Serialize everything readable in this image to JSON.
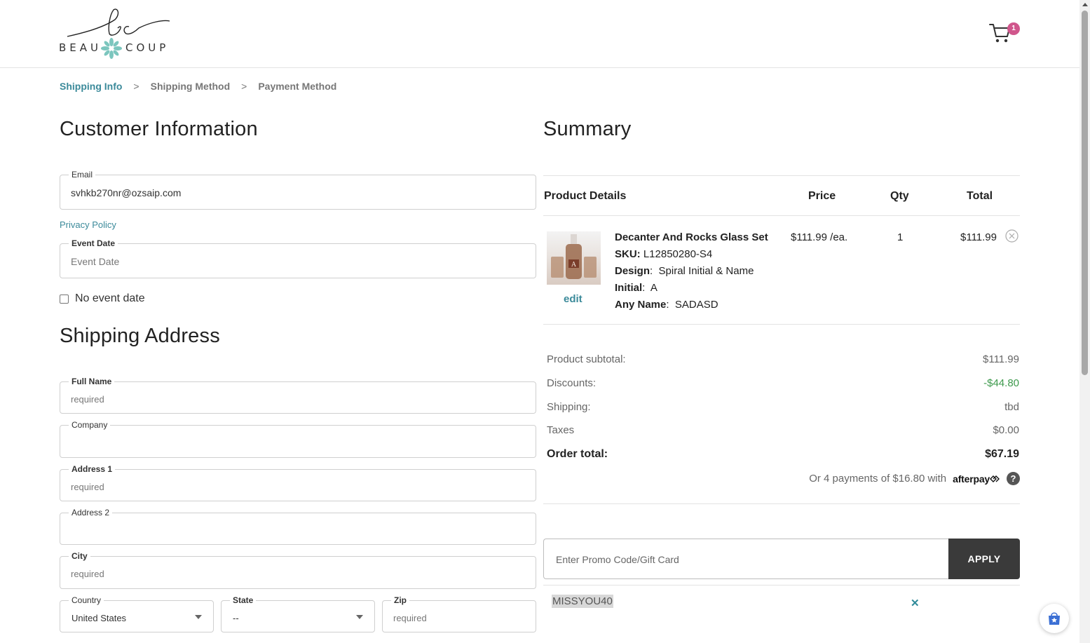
{
  "brand": {
    "logo_text_left": "BEAU",
    "logo_text_right": "COUP",
    "logo_script": "bc"
  },
  "header": {
    "cart_count": "1"
  },
  "breadcrumb": [
    {
      "label": "Shipping Info",
      "active": true
    },
    {
      "label": "Shipping Method",
      "active": false
    },
    {
      "label": "Payment Method",
      "active": false
    }
  ],
  "breadcrumb_separator": ">",
  "customer": {
    "title": "Customer Information",
    "email_label": "Email",
    "email_value": "svhkb270nr@ozsaip.com",
    "privacy_link": "Privacy Policy",
    "event_date_label": "Event Date",
    "event_date_placeholder": "Event Date",
    "no_event_label": "No event date"
  },
  "shipping": {
    "title": "Shipping Address",
    "full_name_label": "Full Name",
    "full_name_placeholder": "required",
    "company_label": "Company",
    "address1_label": "Address 1",
    "address1_placeholder": "required",
    "address2_label": "Address 2",
    "city_label": "City",
    "city_placeholder": "required",
    "country_label": "Country",
    "country_value": "United States",
    "state_label": "State",
    "state_value": "--",
    "zip_label": "Zip",
    "zip_placeholder": "required"
  },
  "summary": {
    "title": "Summary",
    "columns": {
      "product": "Product Details",
      "price": "Price",
      "qty": "Qty",
      "total": "Total"
    },
    "item": {
      "name": "Decanter And Rocks Glass Set",
      "sku_label": "SKU:",
      "sku": "L12850280-S4",
      "design_label": "Design",
      "design": "Spiral Initial & Name",
      "initial_label": "Initial",
      "initial": "A",
      "any_name_label": "Any Name",
      "any_name": "SADASD",
      "price": "$111.99 /ea.",
      "qty": "1",
      "total": "$111.99",
      "edit": "edit"
    },
    "subtotal_label": "Product subtotal:",
    "subtotal": "$111.99",
    "discounts_label": "Discounts:",
    "discounts": "-$44.80",
    "shipping_label": "Shipping:",
    "shipping": "tbd",
    "taxes_label": "Taxes",
    "taxes": "$0.00",
    "order_total_label": "Order total:",
    "order_total": "$67.19",
    "afterpay_text": "Or 4 payments of $16.80 with",
    "afterpay_brand": "afterpay",
    "promo_placeholder": "Enter Promo Code/Gift Card",
    "apply_label": "APPLY",
    "applied_code": "MISSYOU40",
    "remove_glyph": "✕"
  },
  "colors": {
    "accent": "#3b8a9a",
    "discount": "#3e9a4d",
    "badge": "#d0568c",
    "button": "#3a3a3a"
  }
}
